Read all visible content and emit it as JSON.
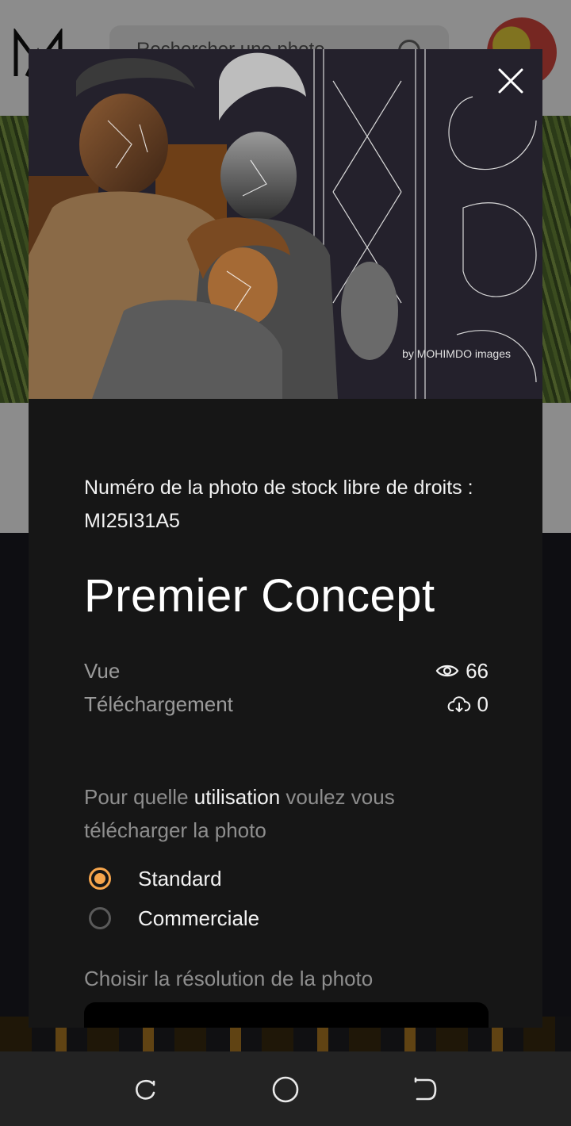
{
  "background": {
    "search_placeholder": "Rechercher une photo"
  },
  "modal": {
    "photo": {
      "watermark": "by MOHIMDO images"
    },
    "photo_number": "Numéro de la photo de stock libre de droits : MI25I31A5",
    "title": "Premier Concept",
    "stats": {
      "views_label": "Vue",
      "views_value": "66",
      "downloads_label": "Téléchargement",
      "downloads_value": "0"
    },
    "usage": {
      "question_part1": "Pour quelle ",
      "question_highlight": "utilisation",
      "question_part2": " voulez vous télécharger la photo",
      "options": [
        {
          "label": "Standard",
          "selected": true
        },
        {
          "label": "Commerciale",
          "selected": false
        }
      ]
    },
    "resolution": {
      "label": "Choisir la résolution de la photo"
    },
    "colors": {
      "accent": "#f6a54c",
      "modal_bg": "#161616"
    }
  }
}
